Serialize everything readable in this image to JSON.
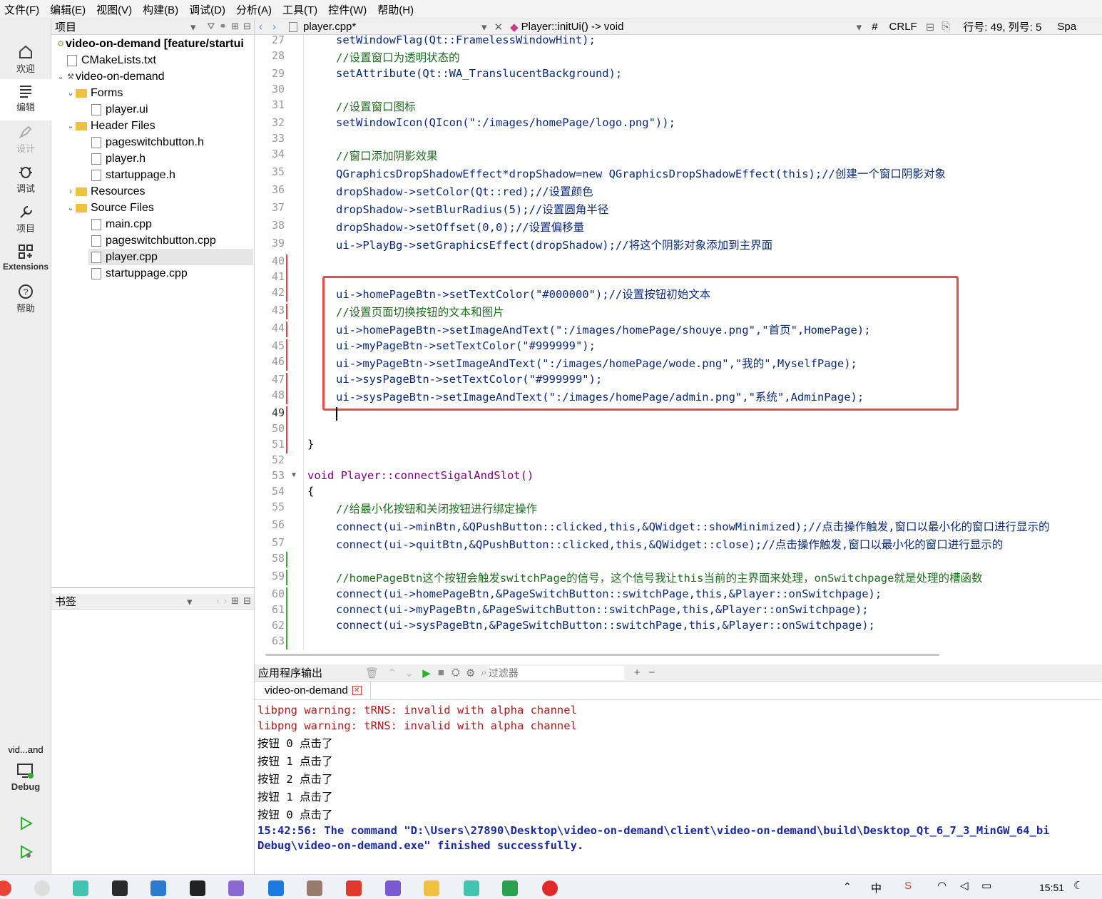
{
  "menu": [
    "文件(F)",
    "编辑(E)",
    "视图(V)",
    "构建(B)",
    "调试(D)",
    "分析(A)",
    "工具(T)",
    "控件(W)",
    "帮助(H)"
  ],
  "modes": {
    "welcome": "欢迎",
    "edit": "编辑",
    "design": "设计",
    "debug": "调试",
    "projects": "项目",
    "extensions": "Extensions",
    "help": "帮助"
  },
  "kit": {
    "project": "vid...and",
    "config": "Debug"
  },
  "projects_pane": {
    "title": "项目",
    "root": "video-on-demand [feature/startui",
    "cmake": "CMakeLists.txt",
    "target": "video-on-demand",
    "forms": "Forms",
    "form_file": "player.ui",
    "headers": "Header Files",
    "h1": "pageswitchbutton.h",
    "h2": "player.h",
    "h3": "startuppage.h",
    "resources": "Resources",
    "sources": "Source Files",
    "s1": "main.cpp",
    "s2": "pageswitchbutton.cpp",
    "s3": "player.cpp",
    "s4": "startuppage.cpp"
  },
  "bookmarks_title": "书签",
  "editor": {
    "file": "player.cpp*",
    "symbol": "Player::initUi() -> void",
    "hash": "#",
    "eol": "CRLF",
    "position": "行号: 49, 列号: 5",
    "indent": "Spa"
  },
  "lines": [
    {
      "n": "27",
      "t": "setWindowFlag(Qt::FramelessWindowHint);"
    },
    {
      "n": "28",
      "t": "//设置窗口为透明状态的"
    },
    {
      "n": "29",
      "t": "setAttribute(Qt::WA_TranslucentBackground);"
    },
    {
      "n": "30",
      "t": ""
    },
    {
      "n": "31",
      "t": "//设置窗口图标"
    },
    {
      "n": "32",
      "t": "setWindowIcon(QIcon(\":/images/homePage/logo.png\"));"
    },
    {
      "n": "33",
      "t": ""
    },
    {
      "n": "34",
      "t": "//窗口添加阴影效果"
    },
    {
      "n": "35",
      "t": "QGraphicsDropShadowEffect*dropShadow=new QGraphicsDropShadowEffect(this);//创建一个窗口阴影对象"
    },
    {
      "n": "36",
      "t": "dropShadow->setColor(Qt::red);//设置颜色"
    },
    {
      "n": "37",
      "t": "dropShadow->setBlurRadius(5);//设置圆角半径"
    },
    {
      "n": "38",
      "t": "dropShadow->setOffset(0,0);//设置偏移量"
    },
    {
      "n": "39",
      "t": "ui->PlayBg->setGraphicsEffect(dropShadow);//将这个阴影对象添加到主界面"
    },
    {
      "n": "40",
      "t": ""
    },
    {
      "n": "41",
      "t": ""
    },
    {
      "n": "42",
      "t": "ui->homePageBtn->setTextColor(\"#000000\");//设置按钮初始文本"
    },
    {
      "n": "43",
      "t": "//设置页面切换按钮的文本和图片"
    },
    {
      "n": "44",
      "t": "ui->homePageBtn->setImageAndText(\":/images/homePage/shouye.png\",\"首页\",HomePage);"
    },
    {
      "n": "45",
      "t": "ui->myPageBtn->setTextColor(\"#999999\");"
    },
    {
      "n": "46",
      "t": "ui->myPageBtn->setImageAndText(\":/images/homePage/wode.png\",\"我的\",MyselfPage);"
    },
    {
      "n": "47",
      "t": "ui->sysPageBtn->setTextColor(\"#999999\");"
    },
    {
      "n": "48",
      "t": "ui->sysPageBtn->setImageAndText(\":/images/homePage/admin.png\",\"系统\",AdminPage);"
    },
    {
      "n": "49",
      "t": ""
    },
    {
      "n": "50",
      "t": ""
    },
    {
      "n": "51",
      "t": "}"
    },
    {
      "n": "52",
      "t": ""
    },
    {
      "n": "53",
      "t": "void Player::connectSigalAndSlot()"
    },
    {
      "n": "54",
      "t": "{"
    },
    {
      "n": "55",
      "t": "//给最小化按钮和关闭按钮进行绑定操作"
    },
    {
      "n": "56",
      "t": "connect(ui->minBtn,&QPushButton::clicked,this,&QWidget::showMinimized);//点击操作触发,窗口以最小化的窗口进行显示的"
    },
    {
      "n": "57",
      "t": "connect(ui->quitBtn,&QPushButton::clicked,this,&QWidget::close);//点击操作触发,窗口以最小化的窗口进行显示的"
    },
    {
      "n": "58",
      "t": ""
    },
    {
      "n": "59",
      "t": "//homePageBtn这个按钮会触发switchPage的信号，这个信号我让this当前的主界面来处理，onSwitchpage就是处理的槽函数"
    },
    {
      "n": "60",
      "t": "connect(ui->homePageBtn,&PageSwitchButton::switchPage,this,&Player::onSwitchpage);"
    },
    {
      "n": "61",
      "t": "connect(ui->myPageBtn,&PageSwitchButton::switchPage,this,&Player::onSwitchpage);"
    },
    {
      "n": "62",
      "t": "connect(ui->sysPageBtn,&PageSwitchButton::switchPage,this,&Player::onSwitchpage);"
    },
    {
      "n": "63",
      "t": ""
    }
  ],
  "output": {
    "title": "应用程序输出",
    "filter_placeholder": "过滤器",
    "tab": "video-on-demand",
    "lines": [
      "libpng warning: tRNS: invalid with alpha channel",
      "libpng warning: tRNS: invalid with alpha channel",
      "按钮 0 点击了",
      "按钮 1 点击了",
      "按钮 2 点击了",
      "按钮 1 点击了",
      "按钮 0 点击了"
    ],
    "final1": "15:42:56: The command \"D:\\Users\\27890\\Desktop\\video-on-demand\\client\\video-on-demand\\build\\Desktop_Qt_6_7_3_MinGW_64_bi",
    "final2": "Debug\\video-on-demand.exe\" finished successfully."
  },
  "taskbar": {
    "time": "15:51",
    "ime": "中"
  },
  "colors": {
    "highlight_box": "#e84b4b",
    "comment": "#1e6d1e",
    "keyword": "#800080",
    "string": "#2b6a2b"
  }
}
